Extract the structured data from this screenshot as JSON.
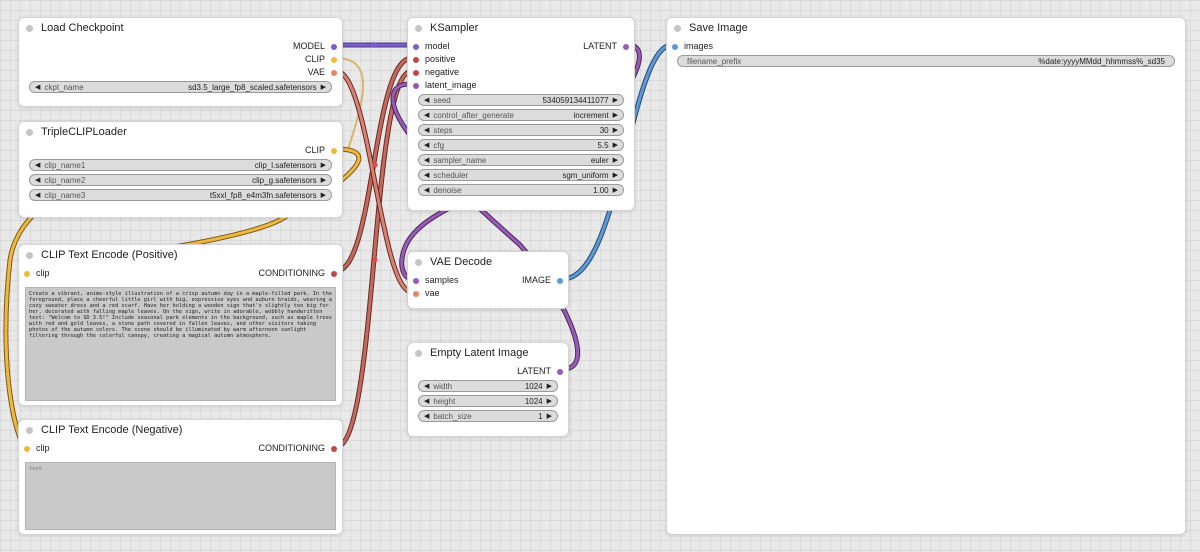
{
  "colors": {
    "model": "#7b5fc9",
    "clip": "#f0b93c",
    "vae": "#e9826a",
    "conditioning": "#c04848",
    "latent": "#9a5ab8",
    "image": "#5a9ad8"
  },
  "nodes": {
    "load_checkpoint": {
      "title": "Load Checkpoint",
      "outputs": [
        "MODEL",
        "CLIP",
        "VAE"
      ],
      "widgets": [
        {
          "name": "ckpt_name",
          "value": "sd3.5_large_fp8_scaled.safetensors"
        }
      ]
    },
    "triple_clip": {
      "title": "TripleCLIPLoader",
      "output": "CLIP",
      "widgets": [
        {
          "name": "clip_name1",
          "value": "clip_l.safetensors"
        },
        {
          "name": "clip_name2",
          "value": "clip_g.safetensors"
        },
        {
          "name": "clip_name3",
          "value": "t5xxl_fp8_e4m3fn.safetensors"
        }
      ]
    },
    "clip_pos": {
      "title": "CLIP Text Encode (Positive)",
      "input": "clip",
      "output": "CONDITIONING",
      "text": "Create a vibrant, anime-style illustration of a crisp autumn day in a maple-filled park. In the foreground, place a cheerful little girl with big, expressive eyes and auburn braids, wearing a cozy sweater dress and a red scarf. Have her holding a wooden sign that's slightly too big for her, decorated with falling maple leaves. On the sign, write in adorable, wobbly handwritten text: \"Welcom to SD 3.5!\" Include seasonal park elements in the background, such as maple trees with red and gold leaves, a stone path covered in fallen leaves, and other visitors taking photos of the autumn colors. The scene should be illuminated by warm afternoon sunlight filtering through the colorful canopy, creating a magical autumn atmosphere."
    },
    "clip_neg": {
      "title": "CLIP Text Encode (Negative)",
      "input": "clip",
      "output": "CONDITIONING",
      "placeholder": "text"
    },
    "ksampler": {
      "title": "KSampler",
      "inputs": [
        "model",
        "positive",
        "negative",
        "latent_image"
      ],
      "output": "LATENT",
      "widgets": [
        {
          "name": "seed",
          "value": "534059134411077"
        },
        {
          "name": "control_after_generate",
          "value": "increment"
        },
        {
          "name": "steps",
          "value": "30"
        },
        {
          "name": "cfg",
          "value": "5.5"
        },
        {
          "name": "sampler_name",
          "value": "euler"
        },
        {
          "name": "scheduler",
          "value": "sgm_uniform"
        },
        {
          "name": "denoise",
          "value": "1.00"
        }
      ]
    },
    "vae_decode": {
      "title": "VAE Decode",
      "inputs": [
        "samples",
        "vae"
      ],
      "output": "IMAGE"
    },
    "empty_latent": {
      "title": "Empty Latent Image",
      "output": "LATENT",
      "widgets": [
        {
          "name": "width",
          "value": "1024"
        },
        {
          "name": "height",
          "value": "1024"
        },
        {
          "name": "batch_size",
          "value": "1"
        }
      ]
    },
    "save_image": {
      "title": "Save Image",
      "input": "images",
      "widgets": [
        {
          "name": "filename_prefix",
          "value": "%date:yyyyMMdd_hhmmss%_sd35"
        }
      ]
    }
  }
}
